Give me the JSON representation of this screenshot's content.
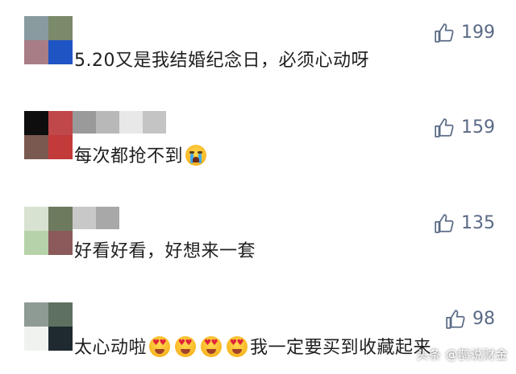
{
  "comments": [
    {
      "text": "5.20又是我结婚纪念日，必须心动呀",
      "likes": "199"
    },
    {
      "text": "每次都抢不到",
      "likes": "159"
    },
    {
      "text": "好看好看，好想来一套",
      "likes": "135"
    },
    {
      "text": "太心动啦",
      "text_after": "我一定要买到收藏起来",
      "likes": "98"
    }
  ],
  "icons": {
    "like": "thumbs-up-icon",
    "cry": "crying-face-emoji",
    "heart_eyes": "heart-eyes-emoji"
  },
  "colors": {
    "like_text": "#5a6a86",
    "text": "#1f1f1f",
    "background": "#ffffff"
  },
  "watermark": "头条 @鹊说财金"
}
